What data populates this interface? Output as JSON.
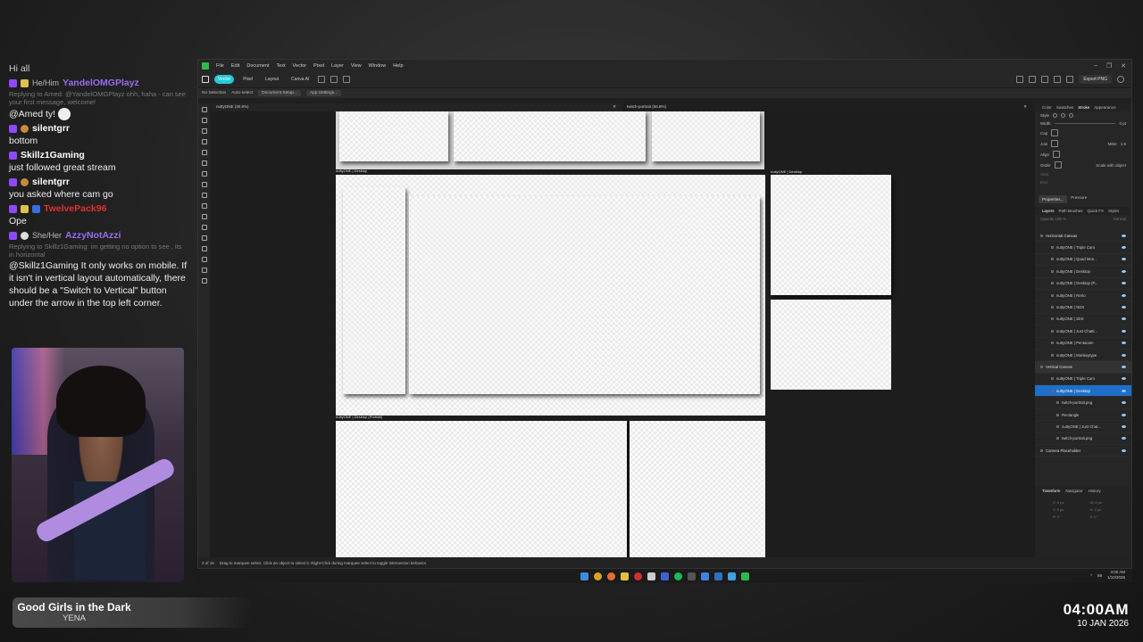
{
  "chat": {
    "intro": "Hi all",
    "messages": [
      {
        "pronouns": "He/Him",
        "user": "YandelOMGPlayz",
        "user_color": "#9a6cf0",
        "reply": "Replying to Amed: @YandelOMGPlayz ohh, haha - can see your first message, welcome!",
        "text": ""
      },
      {
        "pronouns": "",
        "user": "",
        "user_color": "",
        "reply": "",
        "text": "@Amed ty!"
      },
      {
        "pronouns": "",
        "user": "silentgrr",
        "user_color": "#ffffff",
        "reply": "",
        "text": "bottom"
      },
      {
        "pronouns": "",
        "user": "Skillz1Gaming",
        "user_color": "#ffffff",
        "reply": "",
        "text": "just followed great stream"
      },
      {
        "pronouns": "",
        "user": "silentgrr",
        "user_color": "#ffffff",
        "reply": "",
        "text": "you asked where cam go"
      },
      {
        "pronouns": "",
        "user": "TwelvePack96",
        "user_color": "#e03030",
        "reply": "",
        "text": "Ope"
      },
      {
        "pronouns": "She/Her",
        "user": "AzzyNotAzzi",
        "user_color": "#9a6cf0",
        "reply": "Replying to Skillz1Gaming: im getting no option to see , its in horizontal",
        "text": "@Skillz1Gaming It only works on mobile. If it isn't in vertical layout automatically, there should be a \"Switch to Vertical\" button under the arrow in the top left corner."
      }
    ]
  },
  "now_playing": {
    "title": "Good Girls in the Dark",
    "artist": "YENA"
  },
  "clock": {
    "time": "04:00AM",
    "date": "10 JAN 2026"
  },
  "app": {
    "menu": [
      "File",
      "Edit",
      "Document",
      "Text",
      "Vector",
      "Pixel",
      "Layer",
      "View",
      "Window",
      "Help"
    ],
    "personas": [
      "Vector",
      "Pixel",
      "Layout",
      "Canva AI"
    ],
    "export_label": "Export PNG",
    "context": {
      "selection": "No Selection",
      "auto_select": "Auto-select",
      "doc_setup": "Document Setup...",
      "app_settings": "App Settings..."
    },
    "tabs": [
      {
        "label": "nuttyONE (30.8%)"
      },
      {
        "label": "twitch-portrait (56.8%)"
      }
    ],
    "artboards": {
      "desktop": "nuttyONE | Desktop",
      "desktop_portrait": "nuttyONE | Desktop (Portrait)",
      "desktop_right": "nuttyONE | Desktop"
    },
    "status": {
      "page": "3 of 15",
      "hint": "Drag to marquee select. Click an object to select it. Right-Click during marquee select to toggle intersection behavior."
    },
    "right_tabs": [
      "Color",
      "Swatches",
      "Stroke",
      "Appearance"
    ],
    "stroke": {
      "style": "Style",
      "width": "Width",
      "width_val": "0 pt",
      "cap": "Cap",
      "join": "Join",
      "align": "Align",
      "mitre": "Mitre",
      "mitre_val": "1.5",
      "order": "Order",
      "scale": "Scale with object",
      "start": "Start",
      "end": "End"
    },
    "properties": [
      "Properties...",
      "Pressure"
    ],
    "layer_tabs": [
      "Layers",
      "Path Brushes",
      "Quick FX",
      "Styles"
    ],
    "layer_opacity": "Opacity 100 %",
    "layer_blend": "Normal",
    "layers": [
      {
        "name": "Horizontal Canvas",
        "type": "grp"
      },
      {
        "name": "nuttyONE | Triple Cam",
        "type": "sub"
      },
      {
        "name": "nuttyONE | Quad Mon...",
        "type": "sub"
      },
      {
        "name": "nuttyONE | Desktop",
        "type": "sub"
      },
      {
        "name": "nuttyONE | Desktop (P...",
        "type": "sub"
      },
      {
        "name": "nuttyONE | Retro",
        "type": "sub"
      },
      {
        "name": "nuttyONE | NDS",
        "type": "sub"
      },
      {
        "name": "nuttyONE | 3DS",
        "type": "sub"
      },
      {
        "name": "nuttyONE | Just Chatti...",
        "type": "sub"
      },
      {
        "name": "nuttyONE | Pentacam",
        "type": "sub"
      },
      {
        "name": "nuttyONE | Monkeytype",
        "type": "sub"
      },
      {
        "name": "Vertical Canvas",
        "type": "grp-hl"
      },
      {
        "name": "nuttyONE | Triple Cam",
        "type": "sub"
      },
      {
        "name": "nuttyONE | Desktop",
        "type": "sel"
      },
      {
        "name": "twitch-portrait.png",
        "type": "sub2"
      },
      {
        "name": "Rectangle",
        "type": "sub2"
      },
      {
        "name": "nuttyONE | Just Chat...",
        "type": "sub2"
      },
      {
        "name": "twitch-portrait.png",
        "type": "sub2"
      },
      {
        "name": "Camera Placeholder",
        "type": "grp"
      }
    ],
    "transform_tabs": [
      "Transform",
      "Navigator",
      "History"
    ],
    "transform": {
      "x": "X: 0 px",
      "y": "Y: 0 px",
      "w": "W: 0 px",
      "h": "H: 0 px",
      "r": "R: 0 °",
      "s": "S: 0 °"
    }
  },
  "taskbar": {
    "tray_time": "4:00 AM",
    "tray_date": "1/10/2026",
    "tray_num": "69"
  }
}
